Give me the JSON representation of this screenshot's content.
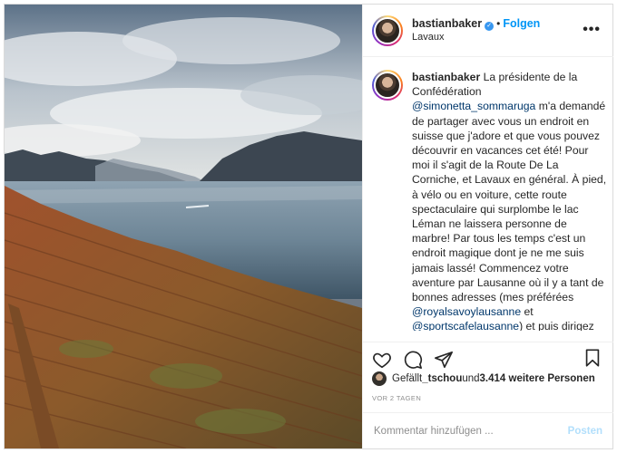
{
  "post": {
    "photo_alt": "",
    "author": {
      "username": "bastianbaker",
      "verified": true,
      "follow_label": "Folgen",
      "location": "Lavaux"
    },
    "more_label": "•••",
    "caption": {
      "username": "bastianbaker",
      "text_before": " La présidente de la Confédération ",
      "mention1": "@simonetta_sommaruga",
      "text_mid1": " m'a demandé de partager avec vous un endroit en suisse que j'adore et que vous pouvez découvrir en vacances cet été! Pour moi il s'agit de la Route De La Corniche, et Lavaux en général. À pied, à vélo ou en voiture, cette route spectaculaire qui surplombe le lac Léman ne laissera personne de marbre! Par tous les temps c'est un endroit magique dont je ne me suis jamais lassé! Commencez votre aventure par Lausanne où il y a tant de bonnes adresses (mes préférées ",
      "mention2": "@royalsavoylausanne",
      "text_mid2": " et ",
      "mention3": "@sportscafelausanne",
      "text_after": ") et puis dirigez vous vers ce petit coin de paradis! Et si vous avez de la chance, peut-être que vous croiserez un bouquetin."
    },
    "actions": {
      "like_icon": "heart-icon",
      "comment_icon": "comment-icon",
      "share_icon": "paper-plane-icon",
      "save_icon": "bookmark-icon"
    },
    "likes": {
      "prefix": "Gefällt ",
      "first_user": "_tschou",
      "middle": " und ",
      "count_text": "3.414 weitere Personen"
    },
    "timestamp": "VOR 2 TAGEN",
    "comment": {
      "placeholder": "Kommentar hinzufügen ...",
      "post_label": "Posten"
    }
  },
  "colors": {
    "link_blue": "#0095f6",
    "mention": "#00376b",
    "muted": "#8e8e8e",
    "post_disabled": "#b2dffc"
  }
}
